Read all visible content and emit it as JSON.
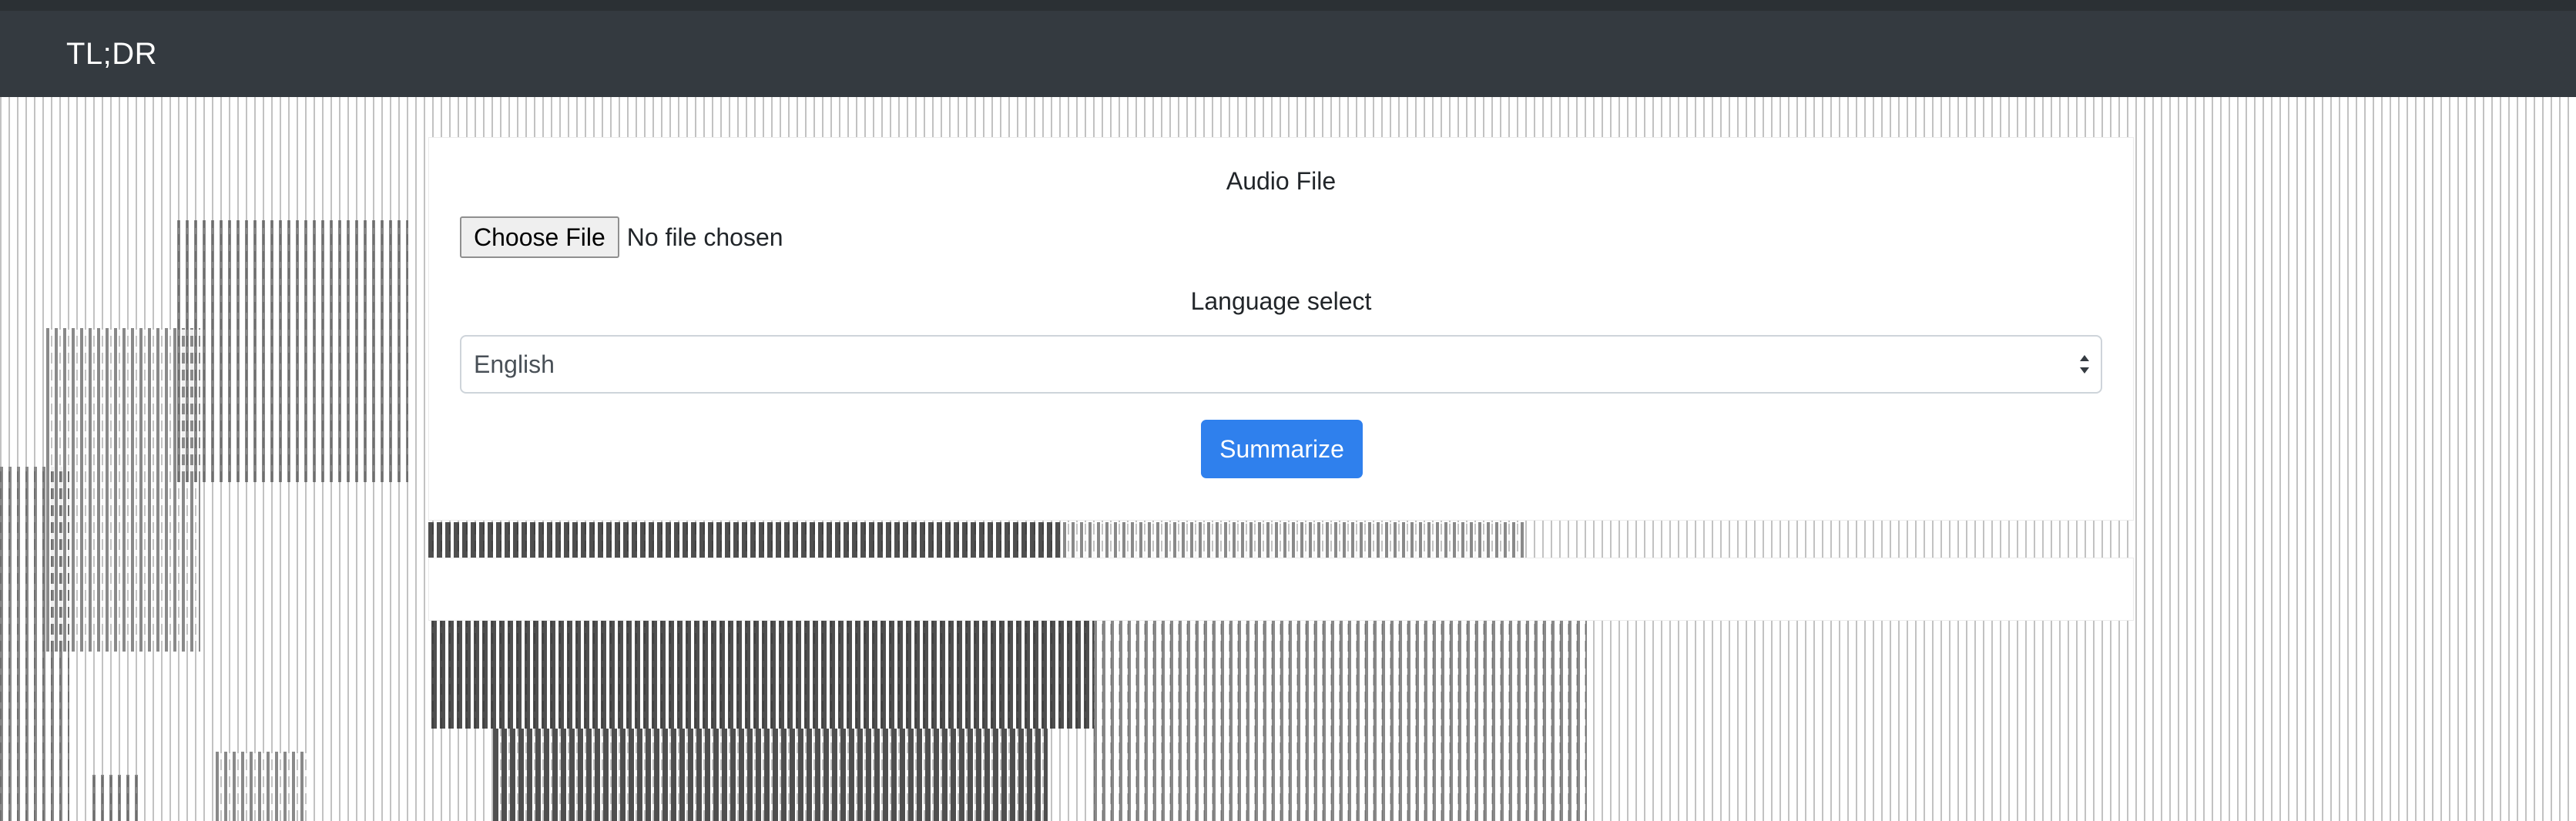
{
  "navbar": {
    "brand": "TL;DR"
  },
  "form": {
    "audio_label": "Audio File",
    "file_button_label": "Choose File",
    "file_status": "No file chosen",
    "language_label": "Language select",
    "language_selected": "English",
    "submit_label": "Summarize"
  },
  "colors": {
    "navbar": "#343a40",
    "primary_button": "#2f80ed"
  },
  "icons": {
    "select_arrows": "updown-chevron-icon"
  }
}
